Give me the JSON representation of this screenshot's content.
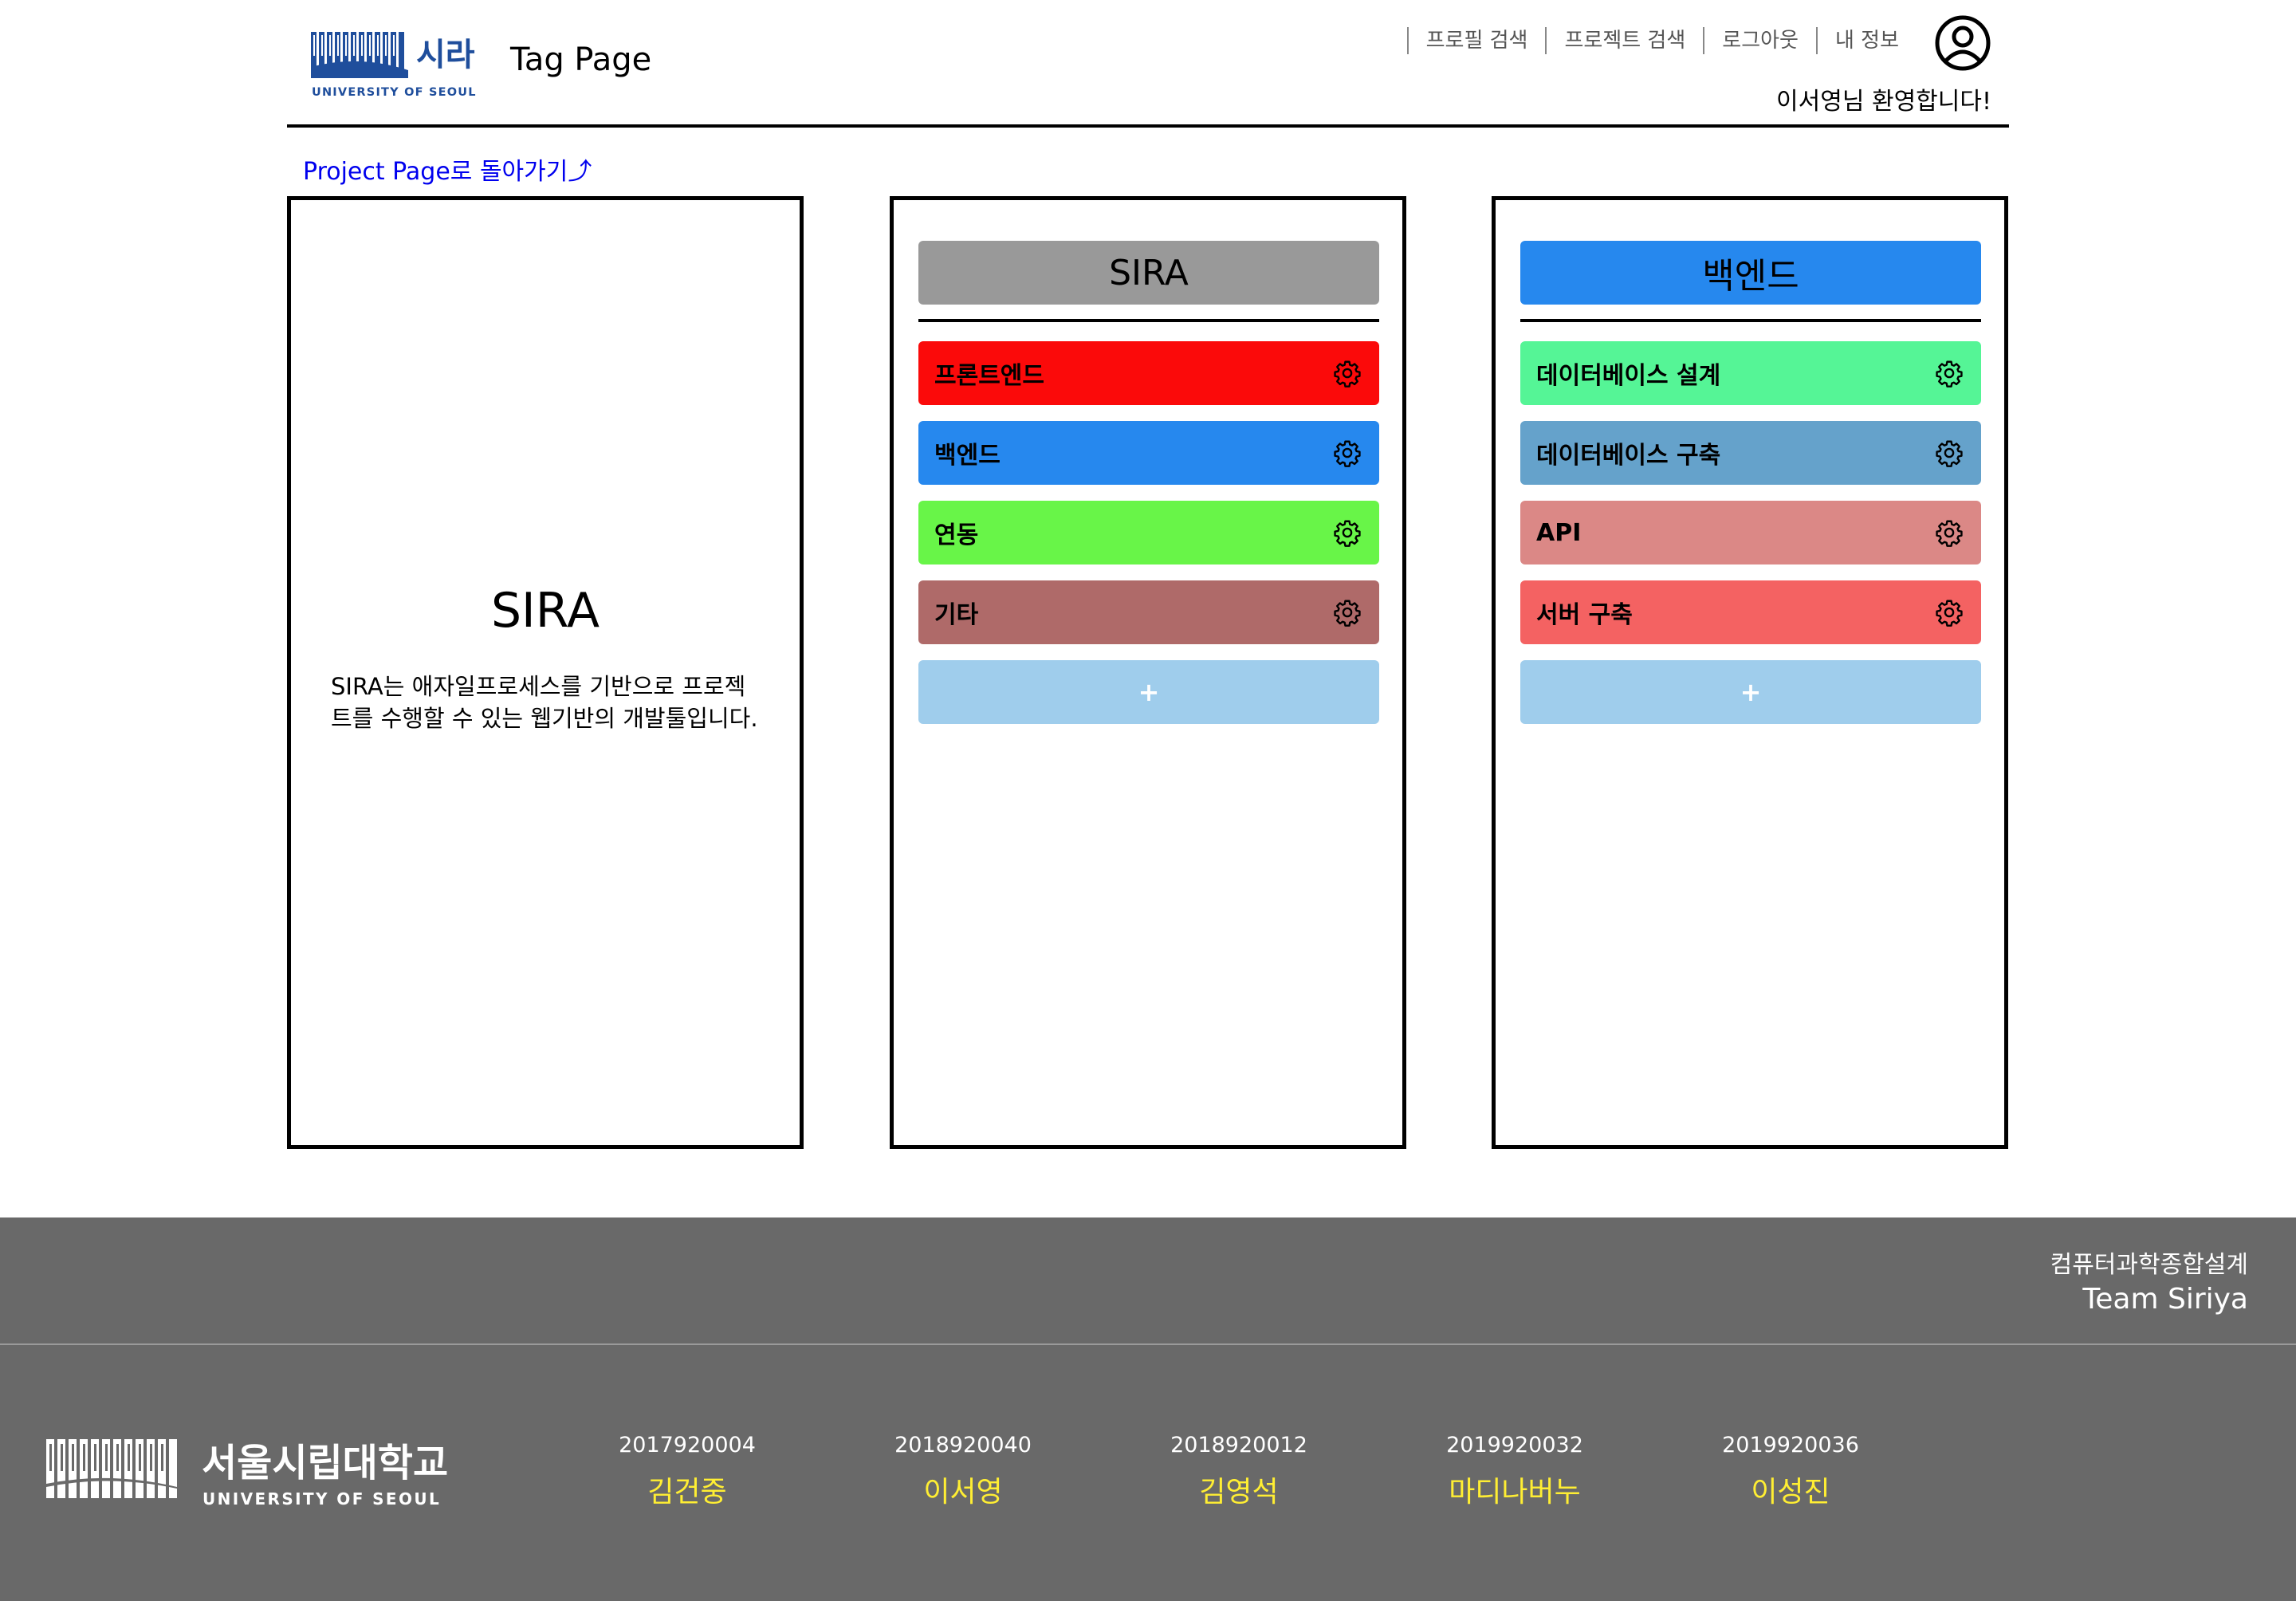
{
  "header": {
    "logo_korean": "시라",
    "logo_english": "UNIVERSITY OF SEOUL",
    "page_title": "Tag Page",
    "nav": [
      "프로필 검색",
      "프로젝트 검색",
      "로그아웃",
      "내 정보"
    ],
    "welcome": "이서영님 환영합니다!"
  },
  "back_link": "Project Page로 돌아가기⤴",
  "project": {
    "title": "SIRA",
    "description": "SIRA는 애자일프로세스를 기반으로 프로젝트를 수행할 수 있는 웹기반의 개발툴입니다."
  },
  "tag_panel": {
    "title": "SIRA",
    "head_color": "#999999",
    "tags": [
      {
        "label": "프론트엔드",
        "color": "#fb0a0a"
      },
      {
        "label": "백엔드",
        "color": "#2688ee"
      },
      {
        "label": "연동",
        "color": "#68f548"
      },
      {
        "label": "기타",
        "color": "#af6a69"
      }
    ],
    "add_label": "+"
  },
  "sub_panel": {
    "title": "백엔드",
    "head_color": "#2688ee",
    "tags": [
      {
        "label": "데이터베이스 설계",
        "color": "#55f596"
      },
      {
        "label": "데이터베이스 구축",
        "color": "#65a2cb"
      },
      {
        "label": "API",
        "color": "#db8886"
      },
      {
        "label": "서버 구축",
        "color": "#f46262"
      }
    ],
    "add_label": "+"
  },
  "footer": {
    "course": "컴퓨터과학종합설계",
    "team": "Team Siriya",
    "logo_korean": "서울시립대학교",
    "logo_english": "UNIVERSITY OF SEOUL",
    "members": [
      {
        "id": "2017920004",
        "name": "김건중"
      },
      {
        "id": "2018920040",
        "name": "이서영"
      },
      {
        "id": "2018920012",
        "name": "김영석"
      },
      {
        "id": "2019920032",
        "name": "마디나버누"
      },
      {
        "id": "2019920036",
        "name": "이성진"
      }
    ]
  },
  "colors": {
    "accent_blue": "#2688ee",
    "link": "#0000ee",
    "footer_bg": "#696969",
    "member_name": "#ffee33"
  }
}
